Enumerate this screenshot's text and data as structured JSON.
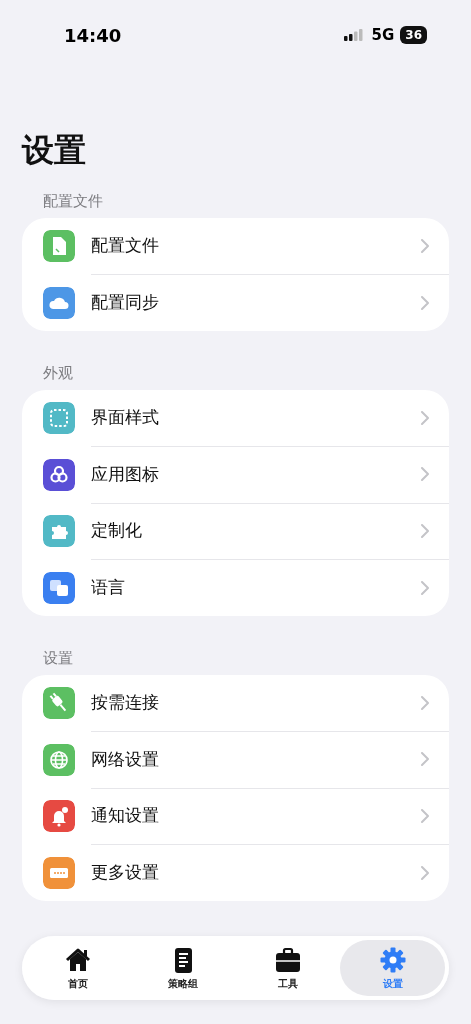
{
  "status_bar": {
    "time": "14:40",
    "network": "5G",
    "battery": "36"
  },
  "title": "设置",
  "sections": [
    {
      "header": "配置文件",
      "items": [
        {
          "label": "配置文件",
          "color": "#5cbf62"
        },
        {
          "label": "配置同步",
          "color": "#4d97e6"
        }
      ]
    },
    {
      "header": "外观",
      "items": [
        {
          "label": "界面样式",
          "color": "#52b9c6"
        },
        {
          "label": "应用图标",
          "color": "#5a4fd6"
        },
        {
          "label": "定制化",
          "color": "#52b9c6"
        },
        {
          "label": "语言",
          "color": "#3a7ff0"
        }
      ]
    },
    {
      "header": "设置",
      "items": [
        {
          "label": "按需连接",
          "color": "#5cbf62"
        },
        {
          "label": "网络设置",
          "color": "#5cbf62"
        },
        {
          "label": "通知设置",
          "color": "#e64a42"
        },
        {
          "label": "更多设置",
          "color": "#f0913a"
        }
      ]
    }
  ],
  "tabs": [
    {
      "label": "首页",
      "selected": false
    },
    {
      "label": "策略组",
      "selected": false
    },
    {
      "label": "工具",
      "selected": false
    },
    {
      "label": "设置",
      "selected": true
    }
  ]
}
